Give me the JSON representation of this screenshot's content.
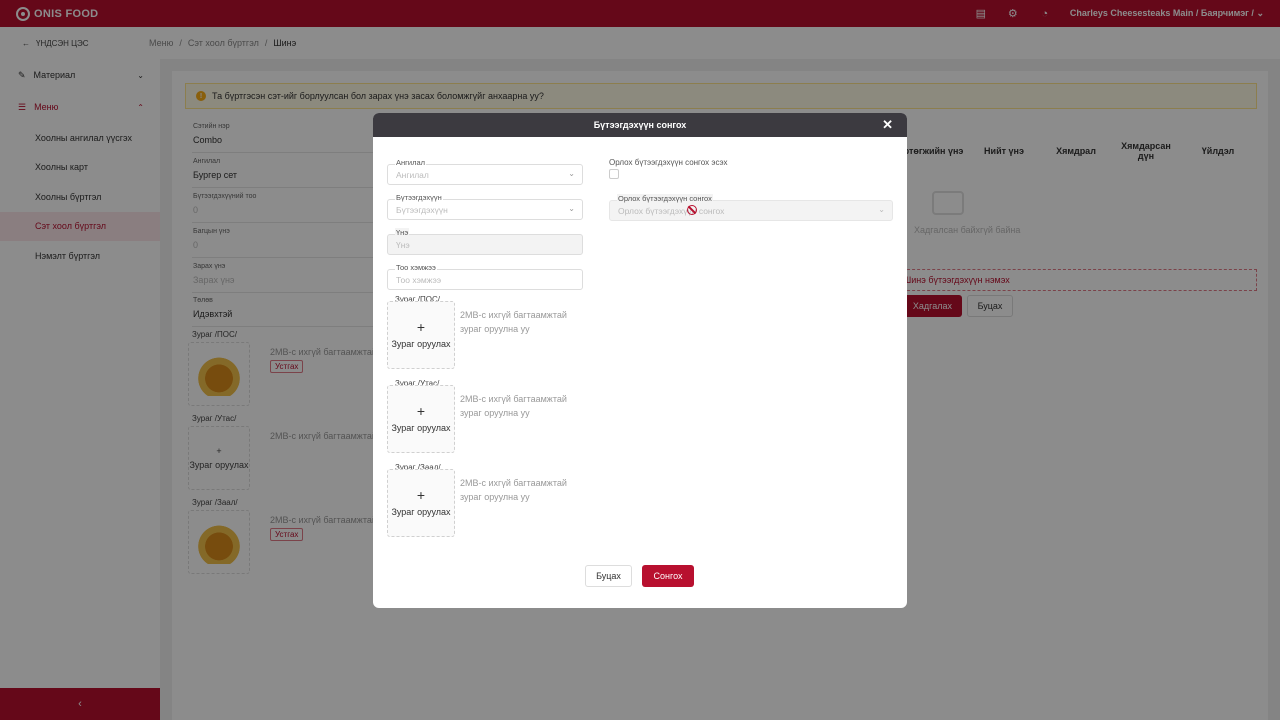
{
  "app": {
    "brand": "ONIS FOOD",
    "store": "Charleys Cheesesteaks Main / Баярчимэг /"
  },
  "subbar": {
    "back_label": "ҮНДСЭН ЦЭС",
    "breadcrumb": [
      "Меню",
      "Сэт хоол бүртгэл",
      "Шинэ"
    ]
  },
  "sidebar": {
    "items": [
      {
        "label": "Материал",
        "icon": "edit-icon",
        "chevron": "⌄"
      },
      {
        "label": "Меню",
        "icon": "list-icon",
        "chevron": "⌃"
      }
    ],
    "subitems": [
      "Хоолны ангилал үүсгэх",
      "Хоолны карт",
      "Хоолны бүртгэл",
      "Сэт хоол бүртгэл",
      "Нэмэлт бүртгэл"
    ],
    "collapse_icon": "‹"
  },
  "page": {
    "alert": "Та бүртгэсэн сэт-ийг борлуулсан бол зарах үнэ засах боломжгүйг анхаарна уу?",
    "fields": [
      {
        "label": "Сэтийн нэр",
        "value": "Combo"
      },
      {
        "label": "Ангилал",
        "value": "Бургер сет"
      },
      {
        "label": "Бүтээгдэхүүний тоо",
        "value": "0"
      },
      {
        "label": "Багцын үнэ",
        "value": "0"
      },
      {
        "label": "Зарах үнэ",
        "value": "Зарах үнэ"
      },
      {
        "label": "Төлөв",
        "value": "Идэвхтэй"
      }
    ],
    "images": [
      {
        "label": "Зураг /ПОС/",
        "hint": "2MB-с ихгүй багтаамжтай з",
        "remove": "Устгах",
        "upload": ""
      },
      {
        "label": "Зураг /Утас/",
        "hint": "2MB-с ихгүй багтаамжтай з",
        "remove": "",
        "upload": "Зураг оруулах"
      },
      {
        "label": "Зураг /Заал/",
        "hint": "2MB-с ихгүй багтаамжтай з",
        "remove": "Устгах",
        "upload": ""
      }
    ],
    "table_headers": [
      "Өртөгжийн үнэ",
      "Нийт үнэ",
      "Хямдрал",
      "Хямдарсан дүн",
      "Үйлдэл"
    ],
    "empty_text": "Хадгалсан байхгүй байна",
    "add_product": "Шинэ бүтээгдэхүүн нэмэх",
    "save_label": "Хадгалах",
    "cancel_label": "Буцах"
  },
  "modal": {
    "title": "Бүтээгдэхүүн сонгох",
    "fields": [
      {
        "label": "Ангилал",
        "placeholder": "Ангилал",
        "dropdown": true,
        "disabled": false
      },
      {
        "label": "Бүтээгдэхүүн",
        "placeholder": "Бүтээгдэхүүн",
        "dropdown": true,
        "disabled": false
      },
      {
        "label": "Үнэ",
        "placeholder": "Үнэ",
        "dropdown": false,
        "disabled": true
      },
      {
        "label": "Тоо хэмжээ",
        "placeholder": "Тоо хэмжээ",
        "dropdown": false,
        "disabled": false
      }
    ],
    "uploads": [
      {
        "label": "Зураг /ПОС/",
        "button": "Зураг оруулах",
        "hint": "2MB-с ихгүй багтаамжтай зураг оруулна уу"
      },
      {
        "label": "Зураг /Утас/",
        "button": "Зураг оруулах",
        "hint": "2MB-с ихгүй багтаамжтай зураг оруулна уу"
      },
      {
        "label": "Зураг /Заал/",
        "button": "Зураг оруулах",
        "hint": "2MB-с ихгүй багтаамжтай зураг оруулна уу"
      }
    ],
    "alt_checkbox_label": "Орлох бүтээгдэхүүн сонгох эсэх",
    "alt_select": {
      "label": "Орлох бүтээгдэхүүн сонгох",
      "placeholder": "Орлох бүтээгдэхүүн сонгох"
    },
    "cancel_label": "Буцах",
    "ok_label": "Сонгох"
  },
  "colors": {
    "brand": "#b8102f",
    "modal_header": "#3c3a40"
  }
}
